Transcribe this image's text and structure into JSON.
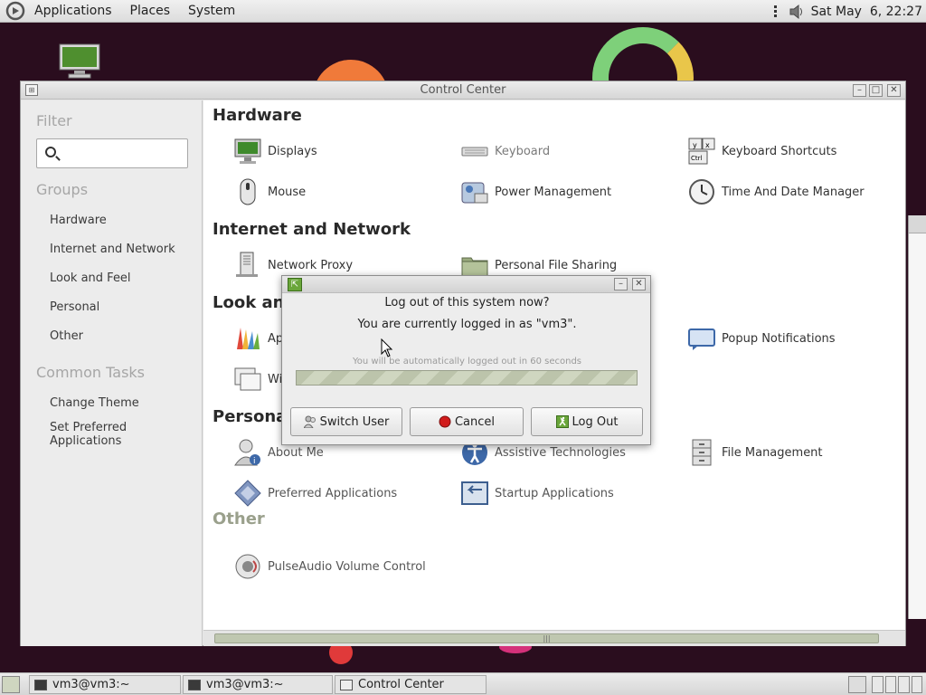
{
  "top_panel": {
    "menus": [
      "Applications",
      "Places",
      "System"
    ],
    "clock": "Sat May  6, 22:27"
  },
  "control_center": {
    "title": "Control Center",
    "sidebar": {
      "filter_heading": "Filter",
      "search_placeholder": "",
      "groups_heading": "Groups",
      "groups": [
        "Hardware",
        "Internet and Network",
        "Look and Feel",
        "Personal",
        "Other"
      ],
      "tasks_heading": "Common Tasks",
      "tasks": [
        "Change Theme",
        "Set Preferred Applications"
      ]
    },
    "sections": {
      "hardware": {
        "title": "Hardware",
        "items": [
          "Displays",
          "Keyboard",
          "Keyboard Shortcuts",
          "Mouse",
          "Power Management",
          "Time And Date Manager"
        ]
      },
      "internet": {
        "title": "Internet and Network",
        "items": [
          "Network Proxy",
          "Personal File Sharing"
        ]
      },
      "look": {
        "title_visible": "Look and",
        "items_visible": [
          "Ap",
          "Wi",
          "Popup Notifications"
        ]
      },
      "personal": {
        "title_visible": "Persona",
        "items": [
          "About Me",
          "Assistive Technologies",
          "File Management",
          "Preferred Applications",
          "Startup Applications"
        ]
      },
      "other": {
        "title": "Other",
        "items": [
          "PulseAudio Volume Control"
        ]
      }
    }
  },
  "logout_dialog": {
    "question": "Log out of this system now?",
    "logged_in_as": "You are currently logged in as \"vm3\".",
    "auto_logout": "You will be automatically logged out in 60 seconds",
    "progress": 1.0,
    "buttons": {
      "switch_user": "Switch User",
      "cancel": "Cancel",
      "log_out": "Log Out"
    }
  },
  "taskbar": {
    "tasks": [
      "vm3@vm3:~",
      "vm3@vm3:~",
      "Control Center"
    ]
  },
  "colors": {
    "desktop": "#2a0d1e",
    "progress": "#bcc4ab",
    "cancel_icon": "#d11c1c",
    "logout_icon": "#6aa63a"
  }
}
